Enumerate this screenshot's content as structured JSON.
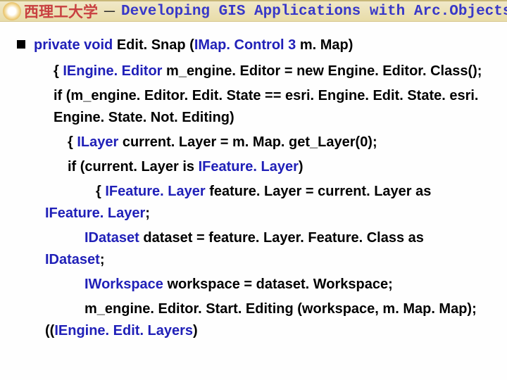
{
  "header": {
    "cn": "西理工大学",
    "dash": "－",
    "en": "Developing GIS Applications with Arc.Objects using C#. NE"
  },
  "code": {
    "sig_a": "private void",
    "sig_b": "Edit. Snap  (",
    "sig_c": "IMap. Control 3",
    "sig_d": "m. Map)",
    "l1a": "{  ",
    "l1b": "IEngine. Editor",
    "l1c": "m_engine. Editor = new Engine. Editor. Class();",
    "l2a": "if (m_engine. Editor. Edit. State == esri. Engine. Edit. State. esri. Engine. State. Not. Editing)",
    "l3a": "{   ",
    "l3b": "ILayer",
    "l3c": "current. Layer = m. Map. get_Layer(0);",
    "l4a": "if (current. Layer is ",
    "l4b": "IFeature. Layer",
    "l4c": ")",
    "l5a": "{  ",
    "l5b": "IFeature. Layer",
    "l5c": "feature. Layer = current. Layer as ",
    "l5d": "IFeature. Layer",
    "l5e": ";",
    "l6a": "IDataset",
    "l6b": "dataset = feature. Layer. Feature. Class as ",
    "l6c": "IDataset",
    "l6d": ";",
    "l7a": "IWorkspace",
    "l7b": "workspace = dataset. Workspace;",
    "l8a": "m_engine. Editor. Start. Editing  (workspace, m. Map. Map);              ((",
    "l8b": "IEngine. Edit. Layers",
    "l8c": ")"
  }
}
